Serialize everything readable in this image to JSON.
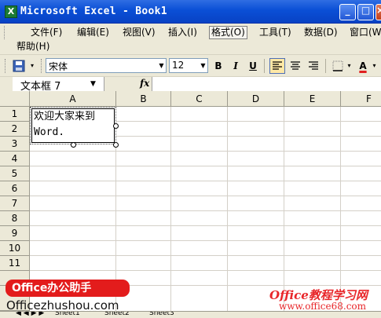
{
  "window": {
    "app_icon": "X",
    "title": "Microsoft Excel - Book1",
    "buttons": {
      "minimize": "_",
      "maximize": "□",
      "close": "×"
    }
  },
  "menu": {
    "items": [
      "文件(F)",
      "编辑(E)",
      "视图(V)",
      "插入(I)",
      "格式(O)",
      "工具(T)",
      "数据(D)",
      "窗口(W)"
    ],
    "help": "帮助(H)",
    "active_index": 4
  },
  "toolbar": {
    "font_name": "宋体",
    "font_size": "12",
    "bold": "B",
    "italic": "I",
    "underline": "U",
    "align_left": "≡",
    "align_center": "≡",
    "align_right": "≡",
    "borders": "▦",
    "font_color": "A",
    "accent_color": "#e02020"
  },
  "formula_bar": {
    "name_box": "文本框 7",
    "fx": "fx",
    "formula": ""
  },
  "grid": {
    "columns": [
      "A",
      "B",
      "C",
      "D",
      "E",
      "F"
    ],
    "rows": [
      "1",
      "2",
      "3",
      "4",
      "5",
      "6",
      "7",
      "8",
      "9",
      "10",
      "11"
    ]
  },
  "textbox": {
    "line1": "欢迎大家来到",
    "line2": "Word."
  },
  "sheet_tabs": {
    "nav": "◀ ◀ ▶ ▶",
    "tabs": [
      "Sheet1",
      "Sheet2",
      "Sheet3"
    ]
  },
  "watermarks": {
    "left_badge": "Office办公助手",
    "left_url": "Officezhushou.com",
    "right_title": "Office教程学习网",
    "right_url": "www.office68.com"
  }
}
